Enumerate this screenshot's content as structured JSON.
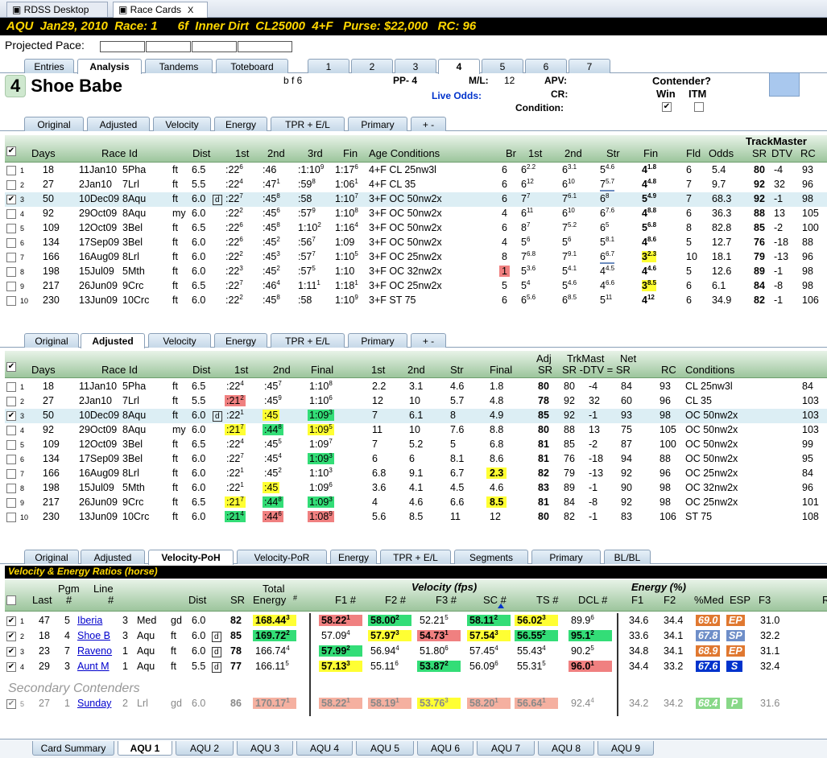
{
  "window": {
    "tabs": [
      "RDSS Desktop",
      "Race Cards"
    ],
    "close": "X"
  },
  "race": {
    "title": "AQU  Jan29, 2010  Race: 1      6f  Inner Dirt  CL25000  4+F   Purse: $22,000   RC: 96"
  },
  "pace": {
    "label": "Projected Pace:"
  },
  "main_tabs": [
    "Entries",
    "Analysis",
    "Tandems",
    "Toteboard",
    "1",
    "2",
    "3",
    "4",
    "5",
    "6",
    "7"
  ],
  "horse": {
    "num": "4",
    "name": "Shoe Babe",
    "sex": "b f 6",
    "pp": "PP- 4",
    "ml_label": "M/L:",
    "ml": "12",
    "live_odds": "Live Odds:",
    "apv": "APV:",
    "cr": "CR:",
    "condition": "Condition:",
    "contender": "Contender?",
    "win": "Win",
    "itm": "ITM"
  },
  "sub_tabs1": [
    "Original",
    "Adjusted",
    "Velocity",
    "Energy",
    "TPR + E/L",
    "Primary",
    "+ -"
  ],
  "t1": {
    "trackmaster": "TrackMaster",
    "headers": [
      "Days",
      "Race Id",
      "Dist",
      "1st",
      "2nd",
      "3rd",
      "Fin",
      "Age Conditions",
      "Br",
      "1st",
      "2nd",
      "Str",
      "Fin",
      "Fld",
      "Odds",
      "SR",
      "DTV",
      "RC"
    ],
    "rows": [
      [
        "1",
        "18",
        "11Jan10",
        "5Pha",
        "ft",
        "6.5",
        ":22",
        "6",
        ":46",
        "",
        ":1:10",
        "9",
        "1:17",
        "6",
        "4+F CL 25nw3l",
        "6",
        "6",
        "2.2",
        "6",
        "3.1",
        "5",
        "4.6",
        "4",
        "1.8",
        "6",
        "5.4",
        "80",
        "-4",
        "93"
      ],
      [
        "2",
        "27",
        "2Jan10",
        "7Lrl",
        "ft",
        "5.5",
        ":22",
        "4",
        ":47",
        "1",
        ":59",
        "8",
        "1:06",
        "1",
        "4+F CL 35",
        "6",
        "6",
        "12",
        "6",
        "10",
        "7",
        "5.7",
        "4",
        "4.8",
        "7",
        "9.7",
        "92",
        "32",
        "96"
      ],
      [
        "3",
        "50",
        "10Dec09",
        "8Aqu",
        "ft",
        "6.0",
        ":22",
        "7",
        ":45",
        "8",
        ":58",
        "",
        "1:10",
        "7",
        "3+F OC 50nw2x",
        "6",
        "7",
        "7",
        "7",
        "6.1",
        "6",
        "8",
        "5",
        "4.9",
        "7",
        "68.3",
        "92",
        "-1",
        "98"
      ],
      [
        "4",
        "92",
        "29Oct09",
        "8Aqu",
        "my",
        "6.0",
        ":22",
        "2",
        ":45",
        "6",
        ":57",
        "9",
        "1:10",
        "8",
        "3+F OC 50nw2x",
        "4",
        "6",
        "11",
        "6",
        "10",
        "6",
        "7.6",
        "4",
        "8.8",
        "6",
        "36.3",
        "88",
        "13",
        "105"
      ],
      [
        "5",
        "109",
        "12Oct09",
        "3Bel",
        "ft",
        "6.5",
        ":22",
        "6",
        ":45",
        "8",
        "1:10",
        "2",
        "1:16",
        "4",
        "3+F OC 50nw2x",
        "6",
        "8",
        "7",
        "7",
        "5.2",
        "6",
        "5",
        "5",
        "6.8",
        "8",
        "82.8",
        "85",
        "-2",
        "100"
      ],
      [
        "6",
        "134",
        "17Sep09",
        "3Bel",
        "ft",
        "6.0",
        ":22",
        "6",
        ":45",
        "2",
        ":56",
        "7",
        "1:09",
        "",
        "3+F OC 50nw2x",
        "4",
        "5",
        "6",
        "5",
        "6",
        "5",
        "8.1",
        "4",
        "8.6",
        "5",
        "12.7",
        "76",
        "-18",
        "88"
      ],
      [
        "7",
        "166",
        "16Aug09",
        "8Lrl",
        "ft",
        "6.0",
        ":22",
        "2",
        ":45",
        "3",
        ":57",
        "7",
        "1:10",
        "5",
        "3+F OC 25nw2x",
        "8",
        "7",
        "6.8",
        "7",
        "9.1",
        "6",
        "6.7",
        "3",
        "2.3",
        "10",
        "18.1",
        "79",
        "-13",
        "96"
      ],
      [
        "8",
        "198",
        "15Jul09",
        "5Mth",
        "ft",
        "6.0",
        ":22",
        "3",
        ":45",
        "2",
        ":57",
        "5",
        "1:10",
        "",
        "3+F OC 32nw2x",
        "1",
        "5",
        "3.6",
        "5",
        "4.1",
        "4",
        "4.5",
        "4",
        "4.6",
        "5",
        "12.6",
        "89",
        "-1",
        "98"
      ],
      [
        "9",
        "217",
        "26Jun09",
        "9Crc",
        "ft",
        "6.5",
        ":22",
        "7",
        ":46",
        "4",
        "1:11",
        "1",
        "1:18",
        "1",
        "3+F OC 25nw2x",
        "5",
        "5",
        "4",
        "5",
        "4.6",
        "4",
        "6.6",
        "3",
        "8.5",
        "6",
        "6.1",
        "84",
        "-8",
        "98"
      ],
      [
        "10",
        "230",
        "13Jun09",
        "10Crc",
        "ft",
        "6.0",
        ":22",
        "2",
        ":45",
        "8",
        ":58",
        "",
        "1:10",
        "9",
        "3+F ST 75",
        "6",
        "6",
        "5.6",
        "6",
        "8.5",
        "5",
        "11",
        "4",
        "12",
        "6",
        "34.9",
        "82",
        "-1",
        "106"
      ]
    ]
  },
  "sub_tabs2": [
    "Original",
    "Adjusted",
    "Velocity",
    "Energy",
    "TPR + E/L",
    "Primary",
    "+ -"
  ],
  "t2": {
    "headers": [
      "Days",
      "Race Id",
      "Dist",
      "1st",
      "2nd",
      "Final",
      "1st",
      "2nd",
      "Str",
      "Final",
      "Adj SR",
      "TrkMast SR -DTV = SR",
      "Net",
      "RC",
      "Conditions"
    ],
    "h_adj": "Adj",
    "h_sr": "SR",
    "h_trk": "TrkMast",
    "h_trk2": "SR -DTV = SR",
    "h_net": "Net",
    "rows": [
      [
        "1",
        "18",
        "11Jan10",
        "5Pha",
        "ft",
        "6.5",
        ":22",
        "4",
        ":45",
        "7",
        "1:10",
        "8",
        "2.2",
        "3.1",
        "4.6",
        "1.8",
        "80",
        "80",
        "-4",
        "84",
        "93",
        "CL 25nw3l",
        "84"
      ],
      [
        "2",
        "27",
        "2Jan10",
        "7Lrl",
        "ft",
        "5.5",
        ":21",
        "2",
        ":45",
        "9",
        "1:10",
        "6",
        "12",
        "10",
        "5.7",
        "4.8",
        "78",
        "92",
        "32",
        "60",
        "96",
        "CL 35",
        "103"
      ],
      [
        "3",
        "50",
        "10Dec09",
        "8Aqu",
        "ft",
        "6.0",
        ":22",
        "1",
        ":45",
        "",
        "1:09",
        "3",
        "7",
        "6.1",
        "8",
        "4.9",
        "85",
        "92",
        "-1",
        "93",
        "98",
        "OC 50nw2x",
        "103"
      ],
      [
        "4",
        "92",
        "29Oct09",
        "8Aqu",
        "my",
        "6.0",
        ":21",
        "7",
        ":44",
        "8",
        "1:09",
        "5",
        "11",
        "10",
        "7.6",
        "8.8",
        "80",
        "88",
        "13",
        "75",
        "105",
        "OC 50nw2x",
        "103"
      ],
      [
        "5",
        "109",
        "12Oct09",
        "3Bel",
        "ft",
        "6.5",
        ":22",
        "4",
        ":45",
        "5",
        "1:09",
        "7",
        "7",
        "5.2",
        "5",
        "6.8",
        "81",
        "85",
        "-2",
        "87",
        "100",
        "OC 50nw2x",
        "99"
      ],
      [
        "6",
        "134",
        "17Sep09",
        "3Bel",
        "ft",
        "6.0",
        ":22",
        "7",
        ":45",
        "4",
        "1:09",
        "3",
        "6",
        "6",
        "8.1",
        "8.6",
        "81",
        "76",
        "-18",
        "94",
        "88",
        "OC 50nw2x",
        "95"
      ],
      [
        "7",
        "166",
        "16Aug09",
        "8Lrl",
        "ft",
        "6.0",
        ":22",
        "1",
        ":45",
        "2",
        "1:10",
        "3",
        "6.8",
        "9.1",
        "6.7",
        "2.3",
        "82",
        "79",
        "-13",
        "92",
        "96",
        "OC 25nw2x",
        "84"
      ],
      [
        "8",
        "198",
        "15Jul09",
        "5Mth",
        "ft",
        "6.0",
        ":22",
        "1",
        ":45",
        "",
        "1:09",
        "6",
        "3.6",
        "4.1",
        "4.5",
        "4.6",
        "83",
        "89",
        "-1",
        "90",
        "98",
        "OC 32nw2x",
        "96"
      ],
      [
        "9",
        "217",
        "26Jun09",
        "9Crc",
        "ft",
        "6.5",
        ":21",
        "7",
        ":44",
        "8",
        "1:09",
        "3",
        "4",
        "4.6",
        "6.6",
        "8.5",
        "81",
        "84",
        "-8",
        "92",
        "98",
        "OC 25nw2x",
        "101"
      ],
      [
        "10",
        "230",
        "13Jun09",
        "10Crc",
        "ft",
        "6.0",
        ":21",
        "4",
        ":44",
        "6",
        "1:08",
        "9",
        "5.6",
        "8.5",
        "11",
        "12",
        "80",
        "82",
        "-1",
        "83",
        "106",
        "ST 75",
        "108"
      ]
    ]
  },
  "sub_tabs3": [
    "Original",
    "Adjusted",
    "Velocity-PoH",
    "Velocity-PoR",
    "Energy",
    "TPR + E/L",
    "Segments",
    "Primary",
    "BL/BL"
  ],
  "t3": {
    "title": "Velocity & Energy Ratios (horse)",
    "velocity": "Velocity (fps)",
    "energy": "Energy (%)",
    "headers": [
      "Last",
      "Pgm #",
      "Line #",
      "Dist",
      "SR",
      "Total Energy #",
      "F1 #",
      "F2 #",
      "F3 #",
      "SC #",
      "TS #",
      "DCL #",
      "F1",
      "F2",
      "%Med",
      "ESP",
      "F3",
      "R"
    ],
    "h_pgm": "Pgm",
    "h_hash": "#",
    "h_line": "Line",
    "h_total": "Total",
    "h_energy": "Energy",
    "rows": [
      [
        "1",
        "47",
        "5",
        "Iberia",
        "3",
        "Med",
        "gd",
        "6.0",
        "82",
        "168.44",
        "3",
        "58.22",
        "1",
        "58.00",
        "2",
        "52.21",
        "5",
        "58.11",
        "2",
        "56.02",
        "3",
        "89.9",
        "6",
        "34.6",
        "34.4",
        "69.0",
        "EP",
        "31.0"
      ],
      [
        "2",
        "18",
        "4",
        "Shoe B",
        "3",
        "Aqu",
        "ft",
        "6.0",
        "85",
        "169.72",
        "2",
        "57.09",
        "4",
        "57.97",
        "3",
        "54.73",
        "1",
        "57.54",
        "3",
        "56.55",
        "2",
        "95.1",
        "2",
        "33.6",
        "34.1",
        "67.8",
        "SP",
        "32.2"
      ],
      [
        "3",
        "23",
        "7",
        "Raveno",
        "1",
        "Aqu",
        "ft",
        "6.0",
        "78",
        "166.74",
        "4",
        "57.99",
        "2",
        "56.94",
        "4",
        "51.80",
        "6",
        "57.45",
        "4",
        "55.43",
        "4",
        "90.2",
        "5",
        "34.8",
        "34.1",
        "68.9",
        "EP",
        "31.1"
      ],
      [
        "4",
        "29",
        "3",
        "Aunt M",
        "1",
        "Aqu",
        "ft",
        "5.5",
        "77",
        "166.11",
        "5",
        "57.13",
        "3",
        "55.11",
        "6",
        "53.87",
        "2",
        "56.09",
        "6",
        "55.31",
        "5",
        "96.0",
        "1",
        "34.4",
        "33.2",
        "67.6",
        "S",
        "32.4"
      ]
    ],
    "secondary": "Secondary Contenders",
    "srow": [
      "5",
      "27",
      "1",
      "Sunday",
      "2",
      "Lrl",
      "gd",
      "6.0",
      "86",
      "170.17",
      "1",
      "58.22",
      "1",
      "58.19",
      "1",
      "53.76",
      "3",
      "58.20",
      "1",
      "56.64",
      "1",
      "92.4",
      "4",
      "34.2",
      "34.2",
      "68.4",
      "P",
      "31.6"
    ]
  },
  "d_box": "d",
  "bottom_tabs": [
    "Card Summary",
    "AQU 1",
    "AQU 2",
    "AQU 3",
    "AQU 4",
    "AQU 5",
    "AQU 6",
    "AQU 7",
    "AQU 8",
    "AQU 9"
  ],
  "colors": {
    "yellow": "#ffff33",
    "green": "#33dd77",
    "red": "#f08080"
  }
}
